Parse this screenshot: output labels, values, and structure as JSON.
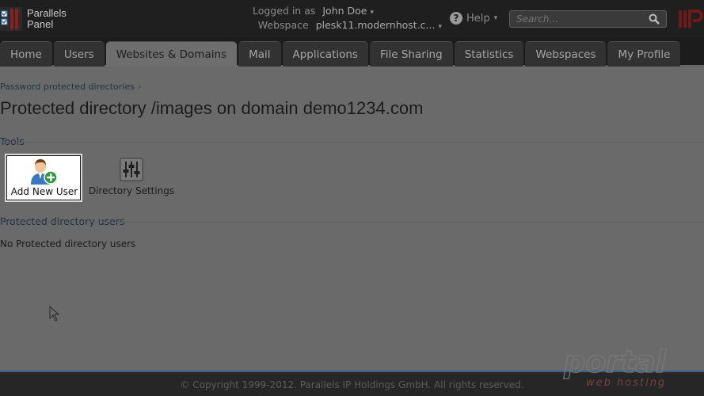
{
  "header": {
    "brand_line1": "Parallels",
    "brand_line2": "Panel",
    "logged_in_label": "Logged in as",
    "user_name": "John Doe",
    "webspace_label": "Webspace",
    "webspace_value": "plesk11.modernhost.c...",
    "help_label": "Help",
    "search_placeholder": "Search..."
  },
  "tabs": [
    {
      "label": "Home"
    },
    {
      "label": "Users"
    },
    {
      "label": "Websites & Domains",
      "active": true
    },
    {
      "label": "Mail"
    },
    {
      "label": "Applications"
    },
    {
      "label": "File Sharing"
    },
    {
      "label": "Statistics"
    },
    {
      "label": "Webspaces"
    },
    {
      "label": "My Profile"
    }
  ],
  "breadcrumb": {
    "item": "Password protected directories",
    "separator": "›"
  },
  "page_title": "Protected directory /images on domain demo1234.com",
  "tools": {
    "section_title": "Tools",
    "add_user_label": "Add New User",
    "directory_settings_label": "Directory Settings"
  },
  "users_section": {
    "title": "Protected directory users",
    "empty_message": "No Protected directory users"
  },
  "footer": {
    "copyright": "© Copyright 1999-2012. Parallels IP Holdings GmbH. All rights reserved."
  },
  "watermark": {
    "line1": "portal",
    "line2": "web hosting"
  },
  "colors": {
    "accent": "#3a5f86",
    "overlay_background": "#6a6a6a",
    "active_tab": "#6e6e6e"
  },
  "icons": [
    "parallels-logo-icon",
    "chevron-down-icon",
    "help-icon",
    "search-icon",
    "add-user-icon",
    "directory-settings-icon",
    "cursor-icon"
  ]
}
